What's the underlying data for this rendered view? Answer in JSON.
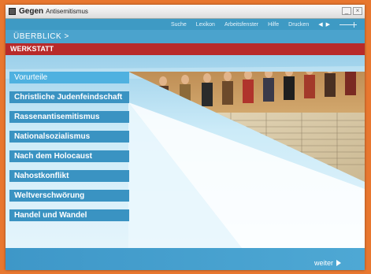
{
  "titlebar": {
    "title": "Gegen",
    "subtitle": "Antisemitismus",
    "buttons": [
      "_",
      "×"
    ]
  },
  "topnav": {
    "links": [
      "Suche",
      "Lexikon",
      "Arbeitsfenster",
      "Hilfe",
      "Drucken"
    ],
    "prev_icon": "◀",
    "next_icon": "▶"
  },
  "breadcrumb": {
    "label": "ÜBERBLICK >"
  },
  "section": {
    "label": "WERKSTATT"
  },
  "menu": {
    "items": [
      {
        "label": "Vorurteile",
        "active": true
      },
      {
        "label": "Christliche Judenfeindschaft",
        "active": false
      },
      {
        "label": "Rassenantisemitismus",
        "active": false
      },
      {
        "label": "Nationalsozialismus",
        "active": false
      },
      {
        "label": "Nach dem Holocaust",
        "active": false
      },
      {
        "label": "Nahostkonflikt",
        "active": false
      },
      {
        "label": "Weltverschwörung",
        "active": false
      },
      {
        "label": "Handel und Wandel",
        "active": false
      }
    ]
  },
  "footer": {
    "next_label": "weiter"
  },
  "colors": {
    "desktop": "#e8772f",
    "nav_blue": "#3e9ac4",
    "section_red": "#b82a2a",
    "menu_blue": "#3a93c2",
    "menu_active": "#4fb1e0"
  }
}
